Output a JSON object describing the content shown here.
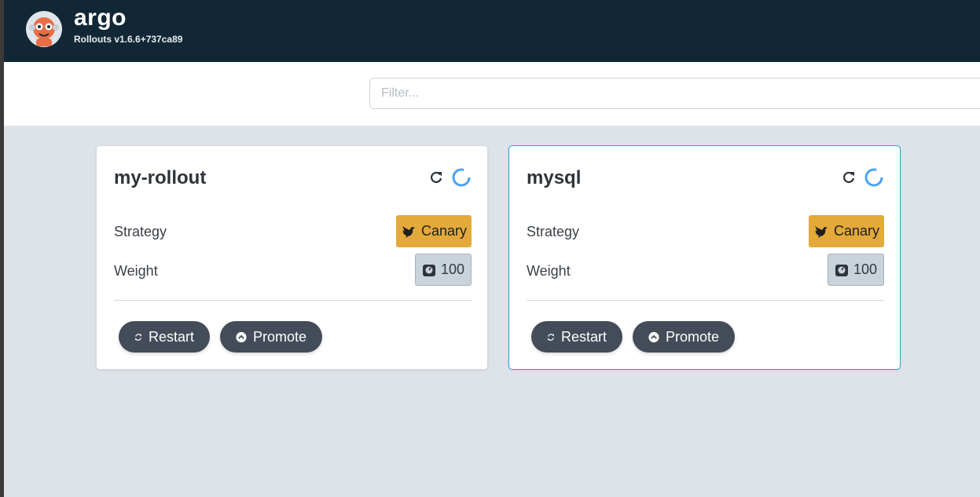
{
  "header": {
    "brand": "argo",
    "version": "Rollouts v1.6.6+737ca89"
  },
  "filter": {
    "placeholder": "Filter...",
    "value": ""
  },
  "labels": {
    "strategy": "Strategy",
    "weight": "Weight",
    "restart": "Restart",
    "promote": "Promote"
  },
  "rollouts": [
    {
      "name": "my-rollout",
      "strategy": "Canary",
      "weight": "100",
      "status": "progressing"
    },
    {
      "name": "mysql",
      "strategy": "Canary",
      "weight": "100",
      "status": "progressing"
    }
  ],
  "colors": {
    "header_bg": "#122735",
    "canary": "#e3a93a",
    "status_spinner": "#4aa3f0",
    "selected_border": "#25a4cc",
    "button_bg": "#434c58"
  },
  "icons": {
    "refresh": "refresh-icon",
    "status": "progressing-spinner-icon",
    "canary": "dove-icon",
    "weight": "scale-icon",
    "restart": "sync-icon",
    "promote": "chevron-circle-up-icon"
  }
}
